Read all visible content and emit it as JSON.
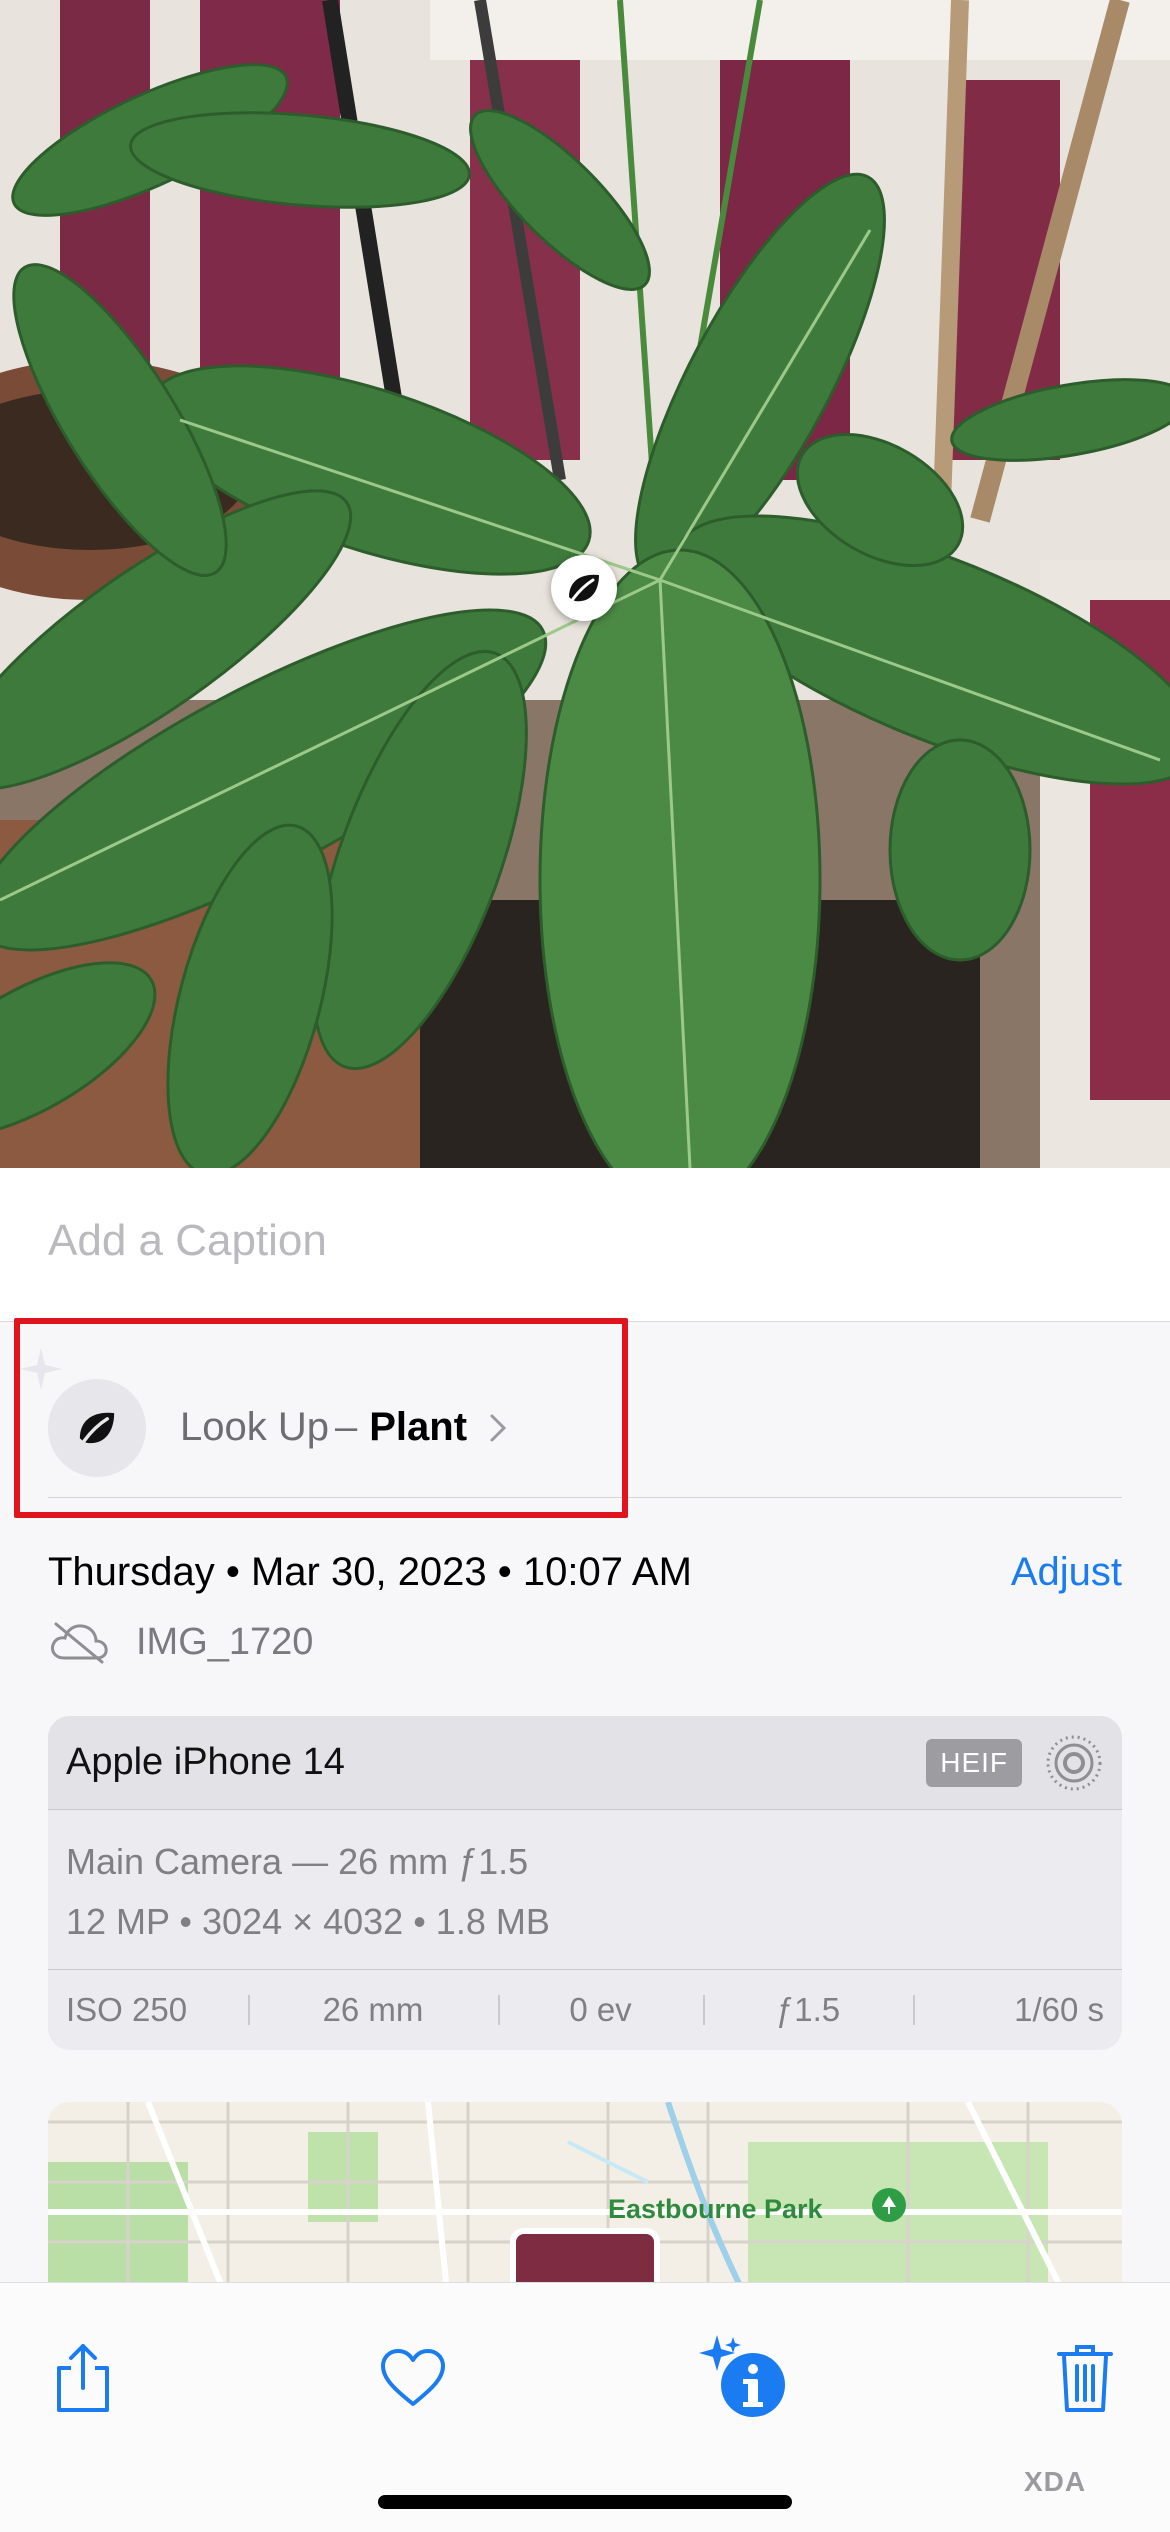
{
  "caption": {
    "placeholder": "Add a Caption"
  },
  "lookup": {
    "prefix": "Look Up",
    "separator": "–",
    "subject": "Plant",
    "chevron": "›"
  },
  "date": {
    "text": "Thursday • Mar 30, 2023 • 10:07 AM",
    "adjust_label": "Adjust"
  },
  "file": {
    "name": "IMG_1720",
    "cloud_status_icon": "cloud-off-icon"
  },
  "camera": {
    "model": "Apple iPhone 14",
    "format_badge": "HEIF",
    "lens": "Main Camera — 26 mm ƒ1.5",
    "specs": "12 MP  •  3024 × 4032  •  1.8 MB",
    "stats": [
      "ISO 250",
      "26 mm",
      "0 ev",
      "ƒ1.5",
      "1/60 s"
    ]
  },
  "map": {
    "place_label": "Eastbourne Park"
  },
  "toolbar": {
    "share_icon": "share-icon",
    "favorite_icon": "heart-icon",
    "info_icon": "info-sparkle-icon",
    "delete_icon": "trash-icon"
  },
  "watermark": "XDA",
  "colors": {
    "accent": "#1a7cf0",
    "highlight": "#e0141c",
    "leaf": "#3f7d3e"
  }
}
